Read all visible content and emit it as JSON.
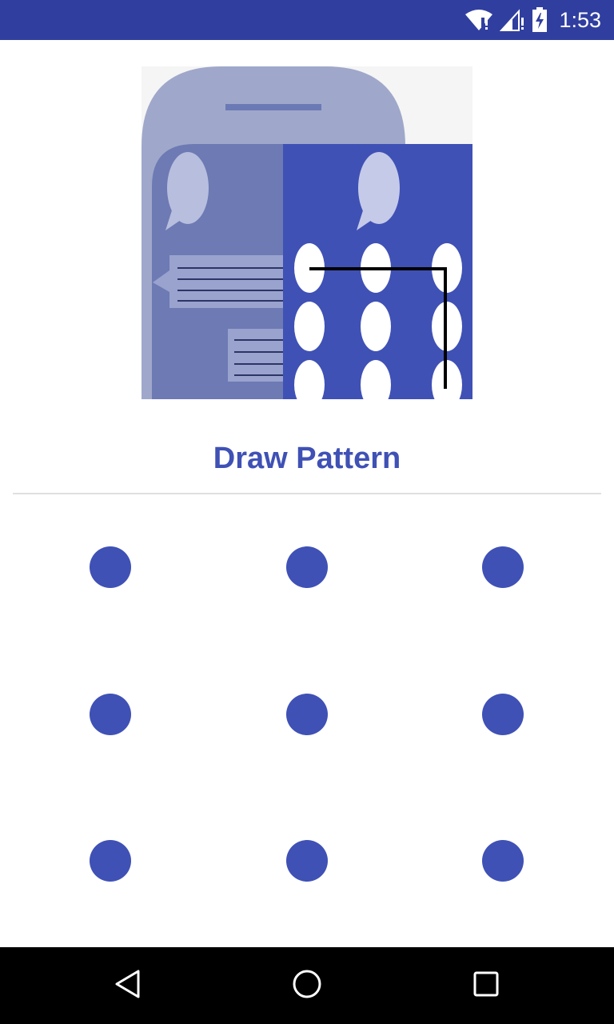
{
  "status_bar": {
    "time": "1:53",
    "icons": [
      "wifi-icon",
      "signal-icon",
      "battery-icon"
    ],
    "color": "#303F9F"
  },
  "illustration": {
    "name": "phone-pattern-lock-illustration"
  },
  "title": "Draw Pattern",
  "pattern": {
    "dots": 9,
    "dot_color": "#3F51B5"
  },
  "nav_bar": {
    "back": "back-icon",
    "home": "home-icon",
    "recents": "recents-icon"
  },
  "colors": {
    "primary": "#3F51B5",
    "primary_dark": "#303F9F"
  }
}
